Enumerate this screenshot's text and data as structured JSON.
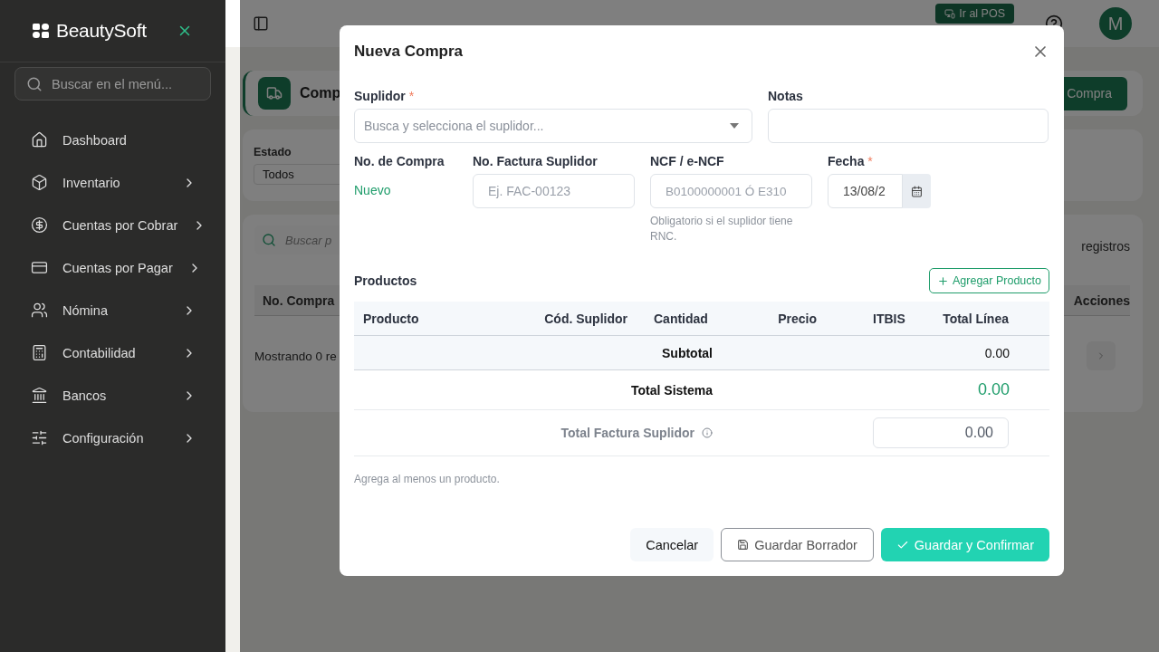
{
  "sidebar": {
    "brand": "BeautySoft",
    "search_placeholder": "Buscar en el menú...",
    "items": [
      {
        "label": "Dashboard",
        "expandable": false
      },
      {
        "label": "Inventario",
        "expandable": true
      },
      {
        "label": "Cuentas por Cobrar",
        "expandable": true
      },
      {
        "label": "Cuentas por Pagar",
        "expandable": true
      },
      {
        "label": "Nómina",
        "expandable": true
      },
      {
        "label": "Contabilidad",
        "expandable": true
      },
      {
        "label": "Bancos",
        "expandable": true
      },
      {
        "label": "Configuración",
        "expandable": true
      }
    ]
  },
  "topbar": {
    "pos_button": "Ir al POS",
    "avatar": "M"
  },
  "page_header": {
    "title": "Comp",
    "action": "Compra"
  },
  "filters": {
    "label": "Estado",
    "value": "Todos"
  },
  "list": {
    "search_placeholder": "Buscar p",
    "records_label": "registros",
    "columns": [
      "No. Compra",
      "Acciones"
    ],
    "footer": "Mostrando 0 re"
  },
  "modal": {
    "title": "Nueva Compra",
    "supplier": {
      "label": "Suplidor",
      "required_mark": "*",
      "placeholder": "Busca y selecciona el suplidor..."
    },
    "notes": {
      "label": "Notas"
    },
    "purchase_no": {
      "label": "No. de Compra",
      "value": "Nuevo"
    },
    "invoice_no": {
      "label": "No. Factura Suplidor",
      "placeholder": "Ej. FAC-00123"
    },
    "ncf": {
      "label": "NCF / e-NCF",
      "placeholder": "B0100000001 Ó E310",
      "hint": "Obligatorio si el suplidor tiene RNC."
    },
    "date": {
      "label": "Fecha",
      "required_mark": "*",
      "value": "13/08/2"
    },
    "products": {
      "title": "Productos",
      "add_button": "Agregar Producto",
      "columns": [
        "Producto",
        "Cód. Suplidor",
        "Cantidad",
        "Precio",
        "ITBIS",
        "Total Línea"
      ],
      "subtotal": {
        "label": "Subtotal",
        "value": "0.00"
      },
      "system_total": {
        "label": "Total Sistema",
        "value": "0.00"
      },
      "invoice_total": {
        "label": "Total Factura Suplidor",
        "value": "0.00"
      }
    },
    "notice": "Agrega al menos un producto.",
    "buttons": [
      {
        "label": "Cancelar",
        "kind": "ghost"
      },
      {
        "label": "Guardar Borrador",
        "kind": "outline"
      },
      {
        "label": "Guardar y Confirmar",
        "kind": "primary"
      }
    ]
  }
}
